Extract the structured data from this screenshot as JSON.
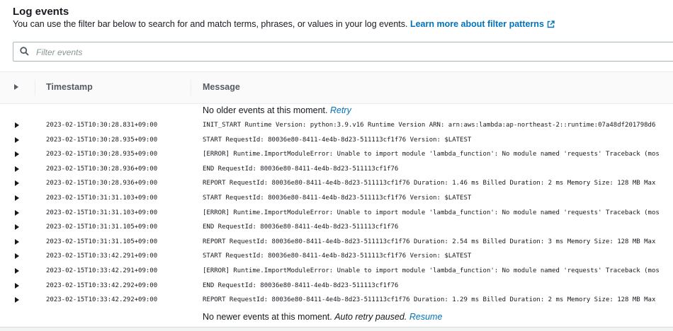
{
  "header": {
    "title": "Log events",
    "description": "You can use the filter bar below to search for and match terms, phrases, or values in your log events.",
    "learn_more_link": "Learn more about filter patterns"
  },
  "filter": {
    "placeholder": "Filter events",
    "icon": "search-icon"
  },
  "table": {
    "columns": [
      "Timestamp",
      "Message"
    ],
    "top_status": {
      "text": "No older events at this moment.",
      "action": "Retry"
    },
    "bottom_status": {
      "text": "No newer events at this moment.",
      "italic": "Auto retry paused.",
      "action": "Resume"
    },
    "rows": [
      {
        "timestamp": "2023-02-15T10:30:28.831+09:00",
        "message": "INIT_START Runtime Version: python:3.9.v16 Runtime Version ARN: arn:aws:lambda:ap-northeast-2::runtime:07a48df201798d6"
      },
      {
        "timestamp": "2023-02-15T10:30:28.935+09:00",
        "message": "START RequestId: 80036e80-8411-4e4b-8d23-511113cf1f76 Version: $LATEST"
      },
      {
        "timestamp": "2023-02-15T10:30:28.935+09:00",
        "message": "[ERROR] Runtime.ImportModuleError: Unable to import module 'lambda_function': No module named 'requests' Traceback (mos"
      },
      {
        "timestamp": "2023-02-15T10:30:28.936+09:00",
        "message": "END RequestId: 80036e80-8411-4e4b-8d23-511113cf1f76"
      },
      {
        "timestamp": "2023-02-15T10:30:28.936+09:00",
        "message": "REPORT RequestId: 80036e80-8411-4e4b-8d23-511113cf1f76 Duration: 1.46 ms Billed Duration: 2 ms Memory Size: 128 MB Max"
      },
      {
        "timestamp": "2023-02-15T10:31:31.103+09:00",
        "message": "START RequestId: 80036e80-8411-4e4b-8d23-511113cf1f76 Version: $LATEST"
      },
      {
        "timestamp": "2023-02-15T10:31:31.103+09:00",
        "message": "[ERROR] Runtime.ImportModuleError: Unable to import module 'lambda_function': No module named 'requests' Traceback (mos"
      },
      {
        "timestamp": "2023-02-15T10:31:31.105+09:00",
        "message": "END RequestId: 80036e80-8411-4e4b-8d23-511113cf1f76"
      },
      {
        "timestamp": "2023-02-15T10:31:31.105+09:00",
        "message": "REPORT RequestId: 80036e80-8411-4e4b-8d23-511113cf1f76 Duration: 2.54 ms Billed Duration: 3 ms Memory Size: 128 MB Max"
      },
      {
        "timestamp": "2023-02-15T10:33:42.291+09:00",
        "message": "START RequestId: 80036e80-8411-4e4b-8d23-511113cf1f76 Version: $LATEST"
      },
      {
        "timestamp": "2023-02-15T10:33:42.291+09:00",
        "message": "[ERROR] Runtime.ImportModuleError: Unable to import module 'lambda_function': No module named 'requests' Traceback (mos"
      },
      {
        "timestamp": "2023-02-15T10:33:42.292+09:00",
        "message": "END RequestId: 80036e80-8411-4e4b-8d23-511113cf1f76"
      },
      {
        "timestamp": "2023-02-15T10:33:42.292+09:00",
        "message": "REPORT RequestId: 80036e80-8411-4e4b-8d23-511113cf1f76 Duration: 1.29 ms Billed Duration: 2 ms Memory Size: 128 MB Max"
      }
    ]
  }
}
